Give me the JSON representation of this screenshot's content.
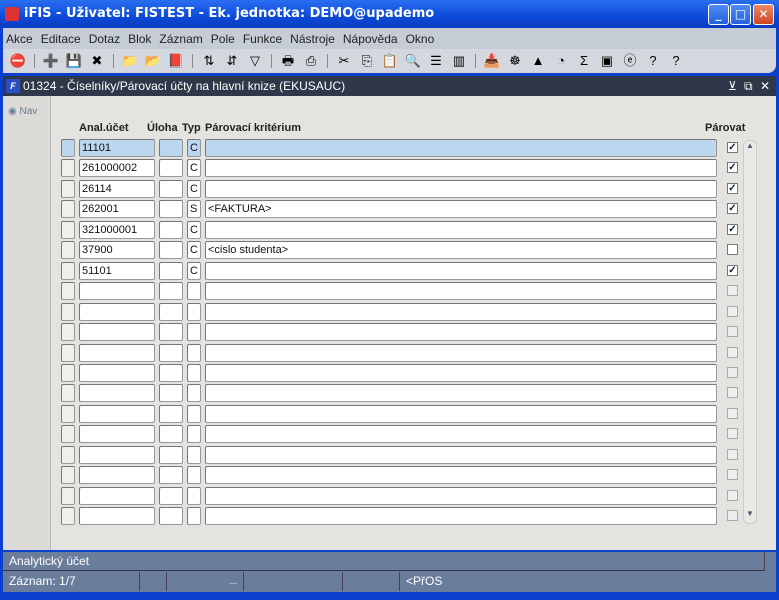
{
  "window": {
    "title": "iFIS - Uživatel: FISTEST - Ek. jednotka: DEMO@upademo",
    "minimize": "_",
    "maximize": "□",
    "close": "✕"
  },
  "menu": [
    "Akce",
    "Editace",
    "Dotaz",
    "Blok",
    "Záznam",
    "Pole",
    "Funkce",
    "Nástroje",
    "Nápověda",
    "Okno"
  ],
  "toolbar": [
    {
      "icon": "exit-icon",
      "glyph": "⛔"
    },
    {
      "sep": true
    },
    {
      "icon": "insert-record-icon",
      "glyph": "➕"
    },
    {
      "icon": "save-icon",
      "glyph": "💾"
    },
    {
      "icon": "delete-record-icon",
      "glyph": "✖"
    },
    {
      "sep": true
    },
    {
      "icon": "query-enter-icon",
      "glyph": "📁"
    },
    {
      "icon": "query-execute-icon",
      "glyph": "📂"
    },
    {
      "icon": "query-cancel-icon",
      "glyph": "📕"
    },
    {
      "sep": true
    },
    {
      "icon": "sort-asc-icon",
      "glyph": "⇅"
    },
    {
      "icon": "sort-desc-icon",
      "glyph": "⇵"
    },
    {
      "icon": "filter-icon",
      "glyph": "▽"
    },
    {
      "sep": true
    },
    {
      "icon": "print-icon",
      "glyph": "🖶"
    },
    {
      "icon": "print-setup-icon",
      "glyph": "⎙"
    },
    {
      "sep": true
    },
    {
      "icon": "cut-icon",
      "glyph": "✂"
    },
    {
      "icon": "copy-icon",
      "glyph": "⎘"
    },
    {
      "icon": "paste-icon",
      "glyph": "📋"
    },
    {
      "icon": "search-icon",
      "glyph": "🔍"
    },
    {
      "icon": "list-icon",
      "glyph": "☰"
    },
    {
      "icon": "columns-icon",
      "glyph": "▥"
    },
    {
      "sep": true
    },
    {
      "icon": "import-icon",
      "glyph": "📥"
    },
    {
      "icon": "wheel-icon",
      "glyph": "☸"
    },
    {
      "icon": "triangle-icon",
      "glyph": "▲"
    },
    {
      "icon": "disk-icon",
      "glyph": "◔"
    },
    {
      "icon": "sum-icon",
      "glyph": "Σ"
    },
    {
      "icon": "excel-icon",
      "glyph": "▣"
    },
    {
      "icon": "browser-icon",
      "glyph": "ⓔ"
    },
    {
      "icon": "help-icon",
      "glyph": "?"
    },
    {
      "icon": "context-help-icon",
      "glyph": "?"
    }
  ],
  "form": {
    "title": "01324 - Číselníky/Párovací účty na hlavní knize (EKUSAUC)",
    "logo": "F",
    "nav": "Nav",
    "headers": {
      "account": "Anal.účet",
      "task": "Úloha",
      "type": "Typ",
      "criterion": "Párovací kritérium",
      "pair": "Párovat"
    },
    "rows": [
      {
        "account": "11101",
        "task": "",
        "type": "C",
        "criterion": "",
        "pair": true
      },
      {
        "account": "261000002",
        "task": "",
        "type": "C",
        "criterion": "",
        "pair": true
      },
      {
        "account": "26114",
        "task": "",
        "type": "C",
        "criterion": "",
        "pair": true
      },
      {
        "account": "262001",
        "task": "",
        "type": "S",
        "criterion": "<FAKTURA>",
        "pair": true
      },
      {
        "account": "321000001",
        "task": "",
        "type": "C",
        "criterion": "",
        "pair": true
      },
      {
        "account": "37900",
        "task": "",
        "type": "C",
        "criterion": "<cislo studenta>",
        "pair": false
      },
      {
        "account": "51101",
        "task": "",
        "type": "C",
        "criterion": "",
        "pair": true
      }
    ],
    "total_rows": 19
  },
  "status": {
    "hint": "Analytický účet",
    "record": "Záznam: 1/7",
    "dots": "...",
    "mode": "<PřOS"
  }
}
